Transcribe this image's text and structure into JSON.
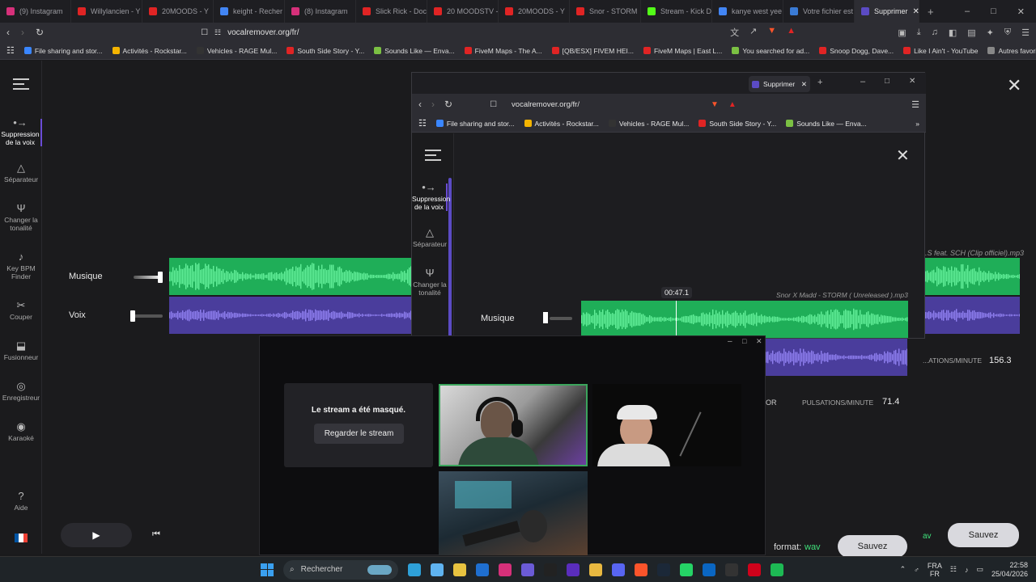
{
  "browser": {
    "tabs": [
      {
        "label": "(9) Instagram",
        "color": "#d6307a"
      },
      {
        "label": "Willylancien - Y",
        "color": "#e02424"
      },
      {
        "label": "20MOODS - Y",
        "color": "#e02424"
      },
      {
        "label": "keight - Recher",
        "color": "#4285f4"
      },
      {
        "label": "(8) Instagram",
        "color": "#d6307a"
      },
      {
        "label": "Slick Rick - Doc",
        "color": "#e02424"
      },
      {
        "label": "20 MOODSTV - ",
        "color": "#e02424"
      },
      {
        "label": "20MOODS - Y",
        "color": "#e02424"
      },
      {
        "label": "Snor - STORM",
        "color": "#e02424"
      },
      {
        "label": "Stream - Kick D",
        "color": "#53fc18"
      },
      {
        "label": "kanye west yee",
        "color": "#4285f4"
      },
      {
        "label": "Votre fichier est",
        "color": "#3a7bd5"
      }
    ],
    "active_tab": "Supprimer",
    "url": "vocalremover.org/fr/",
    "bookmarks": [
      {
        "label": "File sharing and stor...",
        "color": "#3a86ff"
      },
      {
        "label": "Activités - Rockstar...",
        "color": "#f4b400"
      },
      {
        "label": "Vehicles - RAGE Mul...",
        "color": "#333333"
      },
      {
        "label": "South Side Story - Y...",
        "color": "#e02424"
      },
      {
        "label": "Sounds Like — Enva...",
        "color": "#7bc043"
      },
      {
        "label": "FiveM Maps - The A...",
        "color": "#e02424"
      },
      {
        "label": "[QB/ESX] FIVEM HEI...",
        "color": "#e02424"
      },
      {
        "label": "FiveM Maps | East L...",
        "color": "#e02424"
      },
      {
        "label": "You searched for ad...",
        "color": "#7bc043"
      },
      {
        "label": "Snoop Dogg, Dave...",
        "color": "#e02424"
      },
      {
        "label": "Like I Ain't - YouTube",
        "color": "#e02424"
      },
      {
        "label": "Autres favoris",
        "color": "#888888"
      }
    ]
  },
  "sidebar": {
    "items": [
      {
        "label": "Suppression de la voix",
        "icon": "vocal-remover-icon"
      },
      {
        "label": "Séparateur",
        "icon": "splitter-icon"
      },
      {
        "label": "Changer la tonalité",
        "icon": "pitch-icon"
      },
      {
        "label": "Key BPM Finder",
        "icon": "bpm-icon"
      },
      {
        "label": "Couper",
        "icon": "scissors-icon"
      },
      {
        "label": "Fusionneur",
        "icon": "merge-icon"
      },
      {
        "label": "Enregistreur",
        "icon": "mic-icon"
      },
      {
        "label": "Karaoké",
        "icon": "karaoke-icon"
      },
      {
        "label": "Aide",
        "icon": "help-icon"
      }
    ]
  },
  "main": {
    "filename": "...S feat. SCH (Clip officiel).mp3",
    "tracks": [
      {
        "label": "Musique",
        "level": 0.9
      },
      {
        "label": "Voix",
        "level": 0.05
      }
    ],
    "bpm_label": "...ATIONS/MINUTE",
    "bpm_value": "156.3",
    "save_label": "Sauvez"
  },
  "popup": {
    "tab_label": "Supprimer",
    "url": "vocalremover.org/fr/",
    "bookmarks": [
      {
        "label": "File sharing and stor...",
        "color": "#3a86ff"
      },
      {
        "label": "Activités - Rockstar...",
        "color": "#f4b400"
      },
      {
        "label": "Vehicles - RAGE Mul...",
        "color": "#333333"
      },
      {
        "label": "South Side Story - Y...",
        "color": "#e02424"
      },
      {
        "label": "Sounds Like — Enva...",
        "color": "#7bc043"
      }
    ],
    "sidebar": [
      {
        "label": "Suppression de la voix"
      },
      {
        "label": "Séparateur"
      },
      {
        "label": "Changer la tonalité"
      }
    ],
    "time": "00:47.1",
    "filename": "Snor X Madd - STORM ( Unreleased ).mp3",
    "track_label": "Musique",
    "bpm_label": "PULSATIONS/MINUTE",
    "bpm_value": "71.4",
    "key_fragment": "OR",
    "format_label": "format:",
    "format_value": "wav",
    "save_label": "Sauvez"
  },
  "stream": {
    "hidden_text": "Le stream a été masqué.",
    "watch_label": "Regarder le stream"
  },
  "taskbar": {
    "search_label": "Rechercher",
    "lang_top": "FRA",
    "lang_bottom": "FR",
    "time": "22:58",
    "date": "25/04/2026"
  }
}
